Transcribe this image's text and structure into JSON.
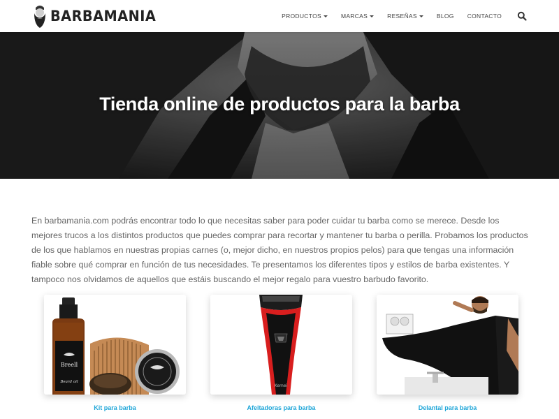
{
  "brand": {
    "name": "BARBAMANIA"
  },
  "nav": {
    "items": [
      {
        "label": "PRODUCTOS",
        "dropdown": true
      },
      {
        "label": "MARCAS",
        "dropdown": true
      },
      {
        "label": "RESEÑAS",
        "dropdown": true
      },
      {
        "label": "BLOG",
        "dropdown": false
      },
      {
        "label": "CONTACTO",
        "dropdown": false
      }
    ],
    "search_icon": "search-icon"
  },
  "hero": {
    "title": "Tienda online de productos para la barba"
  },
  "intro": {
    "text": "En barbamania.com podrás encontrar todo lo que necesitas saber para poder cuidar tu barba como se merece. Desde los mejores trucos a los distintos productos que puedes comprar para recortar y mantener tu barba o perilla. Probamos los productos de los que hablamos en nuestras propias carnes (o, mejor dicho, en nuestros propios pelos) para que tengas una información fiable sobre qué comprar en función de tus necesidades. Te presentamos los diferentes tipos y estilos de barba existentes. Y tampoco nos olvidamos de aquellos que estáis buscando el mejor regalo para vuestro barbudo favorito."
  },
  "cards": [
    {
      "label": "Kit para barba",
      "bottle_text": "Breell",
      "bottle_subtext": "Beard oil"
    },
    {
      "label": "Afeitadoras para barba",
      "device_text": "Kemei"
    },
    {
      "label": "Delantal para barba"
    }
  ],
  "colors": {
    "link": "#1fa6d8",
    "hero_bg": "#2e2e2e",
    "text": "#666666"
  }
}
